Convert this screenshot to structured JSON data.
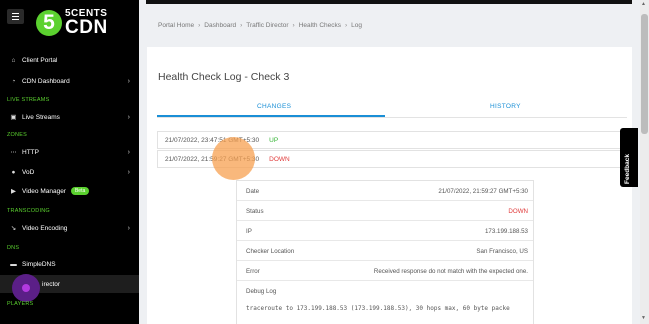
{
  "sidebar": {
    "logo": {
      "digit": "5",
      "line1": "5CENTS",
      "line2": "CDN"
    },
    "items": [
      {
        "label": "Client Portal",
        "icon": "home-icon",
        "glyph": "⌂",
        "chevron": ""
      },
      {
        "label": "CDN Dashboard",
        "icon": "gauge-icon",
        "glyph": "◔",
        "chevron": "›"
      },
      {
        "label": "Live Streams",
        "icon": "stream-icon",
        "glyph": "▣",
        "chevron": "›"
      },
      {
        "label": "HTTP",
        "icon": "http-icon",
        "glyph": "⋯",
        "chevron": "›"
      },
      {
        "label": "VoD",
        "icon": "play-icon",
        "glyph": "●",
        "chevron": "›"
      },
      {
        "label": "Video Manager",
        "icon": "video-icon",
        "glyph": "▶",
        "badge": "Beta",
        "chevron": ""
      },
      {
        "label": "Video Encoding",
        "icon": "encoding-icon",
        "glyph": "↘",
        "chevron": "›"
      },
      {
        "label": "SimpleDNS",
        "icon": "dns-icon",
        "glyph": "▬",
        "chevron": ""
      },
      {
        "label": "irector",
        "icon": "director-icon",
        "glyph": "",
        "chevron": ""
      }
    ],
    "sections": {
      "live": "LIVE STREAMS",
      "zones": "ZONES",
      "transcoding": "TRANSCODING",
      "dns": "DNS",
      "players": "PLAYERS"
    }
  },
  "breadcrumb": [
    "Portal Home",
    "Dashboard",
    "Traffic Director",
    "Health Checks",
    "Log"
  ],
  "page": {
    "title": "Health Check Log - Check 3",
    "tabs": [
      {
        "label": "CHANGES",
        "active": true
      },
      {
        "label": "HISTORY",
        "active": false
      }
    ]
  },
  "log_rows": [
    {
      "timestamp": "21/07/2022, 23:47:51 GMT+5:30",
      "status": "UP"
    },
    {
      "timestamp": "21/07/2022, 21:59:27 GMT+5:30",
      "status": "DOWN"
    }
  ],
  "detail": {
    "rows": [
      {
        "key": "Date",
        "value": "21/07/2022, 21:59:27 GMT+5:30"
      },
      {
        "key": "Status",
        "value": "DOWN"
      },
      {
        "key": "IP",
        "value": "173.199.188.53"
      },
      {
        "key": "Checker Location",
        "value": "San Francisco, US"
      },
      {
        "key": "Error",
        "value": "Received response do not match with the expected one."
      },
      {
        "key": "Debug Log",
        "value": ""
      }
    ],
    "debug_text": "traceroute to 173.199.188.53 (173.199.188.53), 30 hops max, 60 byte packe"
  },
  "feedback_label": "Feedback",
  "colors": {
    "brand": "#5bd12f",
    "accent": "#1a8fd6",
    "up": "#35b535",
    "down": "#e03a3a"
  }
}
